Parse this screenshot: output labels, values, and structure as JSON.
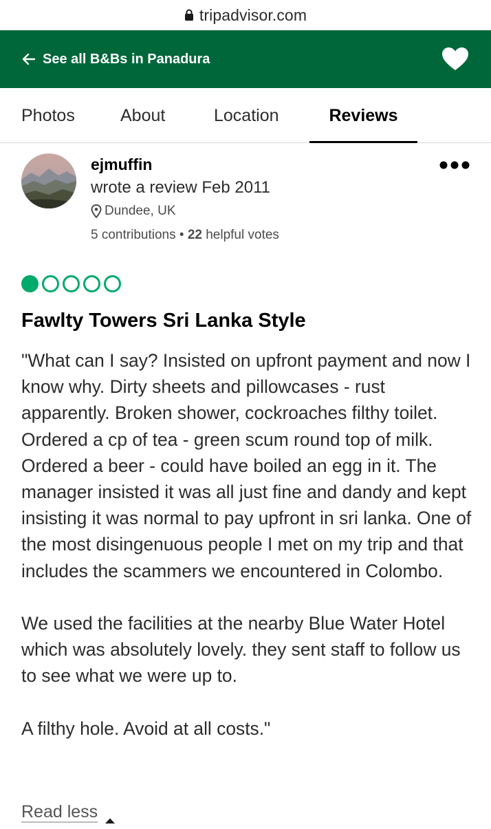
{
  "browser": {
    "url": "tripadvisor.com",
    "lock_icon": "lock-icon"
  },
  "header": {
    "back_label": "See all B&Bs in Panadura",
    "back_icon": "arrow-left-icon",
    "save_icon": "heart-icon",
    "background_color": "#00673a"
  },
  "tabs": [
    {
      "label": "Photos",
      "active": false
    },
    {
      "label": "About",
      "active": false
    },
    {
      "label": "Location",
      "active": false
    },
    {
      "label": "Reviews",
      "active": true
    }
  ],
  "review": {
    "reviewer": {
      "name": "ejmuffin",
      "action": "wrote a review Feb 2011",
      "location": "Dundee, UK",
      "contributions_count": "5",
      "contributions_label": "contributions",
      "separator": "•",
      "helpful_count": "22",
      "helpful_label": "helpful votes"
    },
    "rating": {
      "value": 1,
      "max": 5,
      "color": "#00aa6c"
    },
    "title": "Fawlty Towers Sri Lanka Style",
    "paragraphs": [
      "\"What can I say? Insisted on upfront payment and now I know why. Dirty sheets and pillowcases - rust apparently. Broken shower, cockroaches filthy toilet. Ordered a cp of tea - green scum round top of milk. Ordered a beer - could have boiled an egg in it. The manager insisted it was all just fine and dandy and kept insisting it was normal to pay upfront in sri lanka. One of the most disingenuous people I met on my trip and that includes the scammers we encountered in Colombo.",
      "We used the facilities at the nearby Blue Water Hotel which was absolutely lovely. they sent staff to follow us to see what we were up to.",
      "A filthy hole. Avoid at all costs.\""
    ],
    "read_less_label": "Read less"
  }
}
